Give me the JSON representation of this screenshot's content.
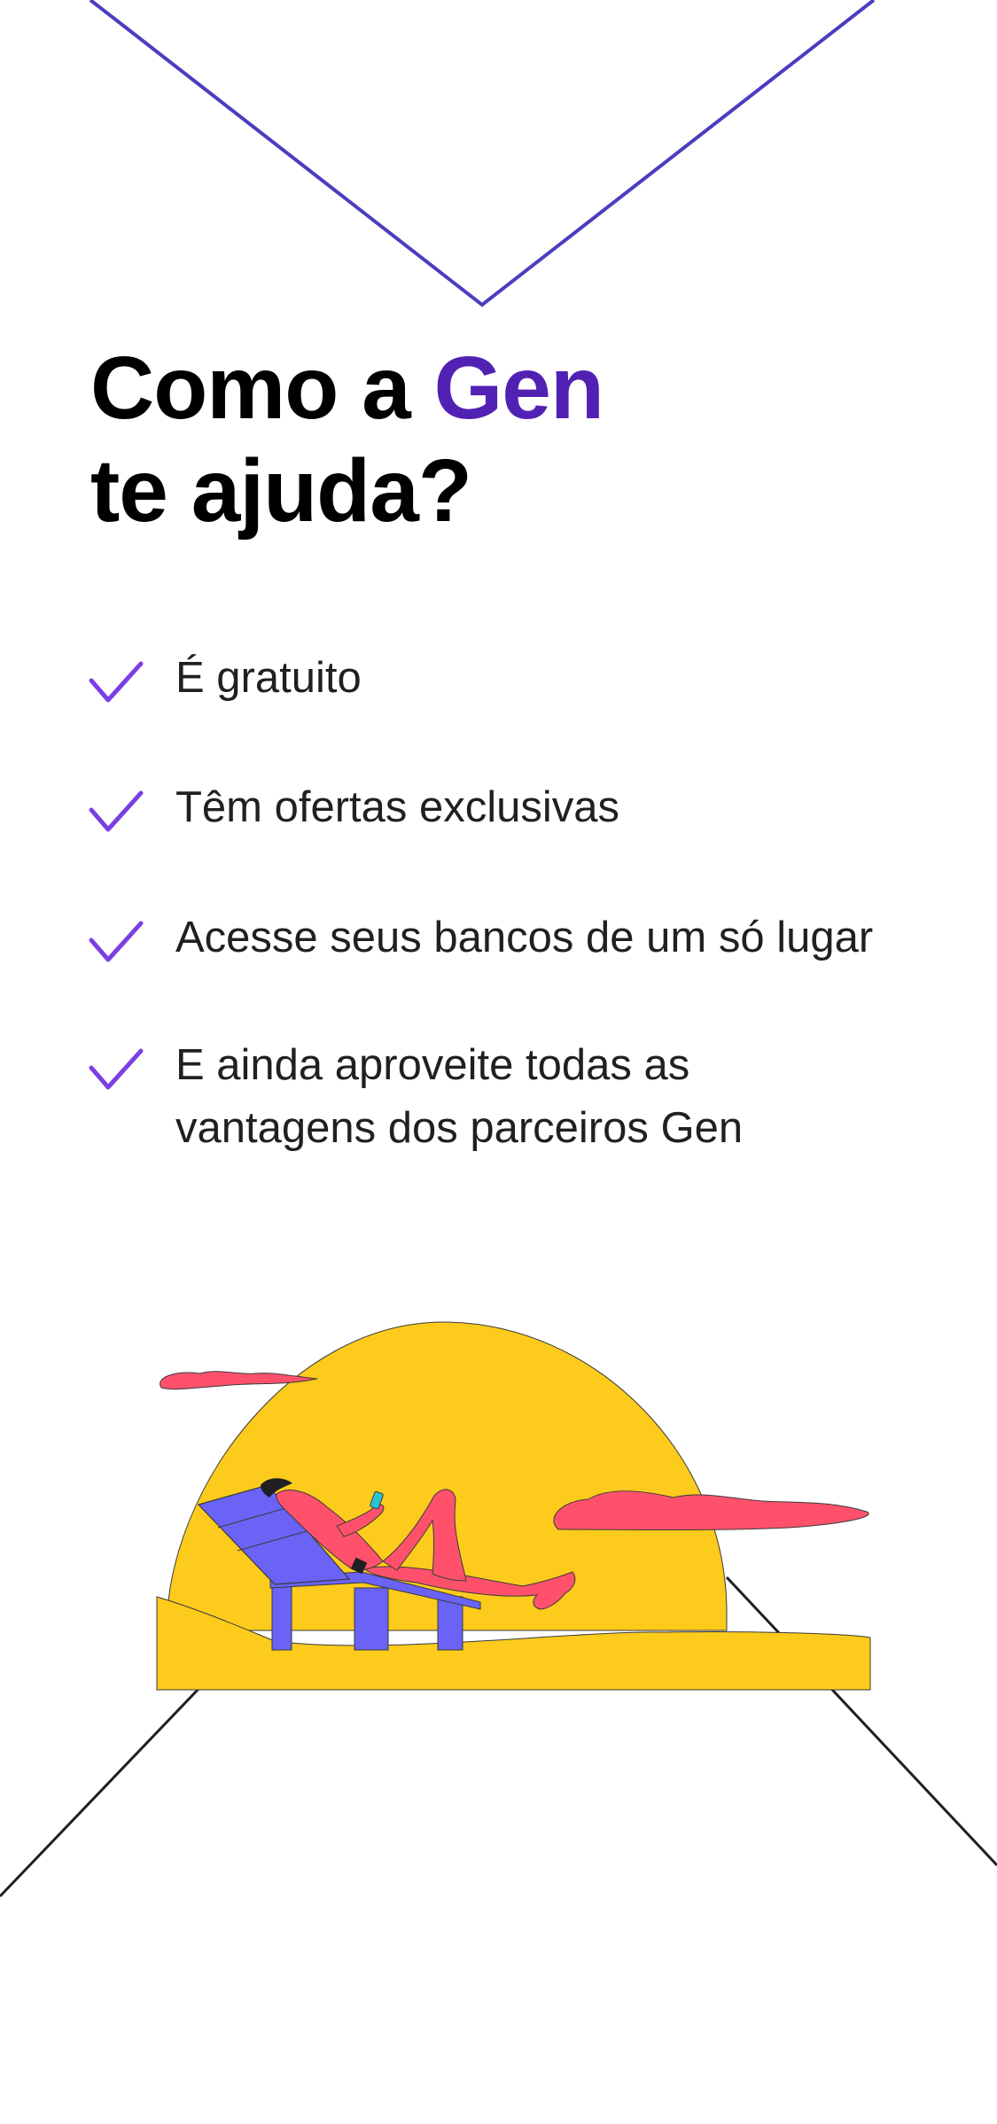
{
  "heading": {
    "line1_prefix": "Como a ",
    "brand": "Gen",
    "line2": "te ajuda?"
  },
  "features": [
    {
      "text": "É gratuito"
    },
    {
      "text": "Têm ofertas exclusivas"
    },
    {
      "text": "Acesse seus bancos de um só lugar"
    },
    {
      "text": "E ainda aproveite todas as vantagens dos parceiros Gen"
    }
  ],
  "colors": {
    "brand": "#5121b4",
    "check": "#7b3fe4",
    "top_line": "#4a3dbf",
    "sun": "#fccb1c",
    "cloud": "#ff516c",
    "chair": "#6a63f5"
  },
  "icons": {
    "check": "check-icon"
  }
}
